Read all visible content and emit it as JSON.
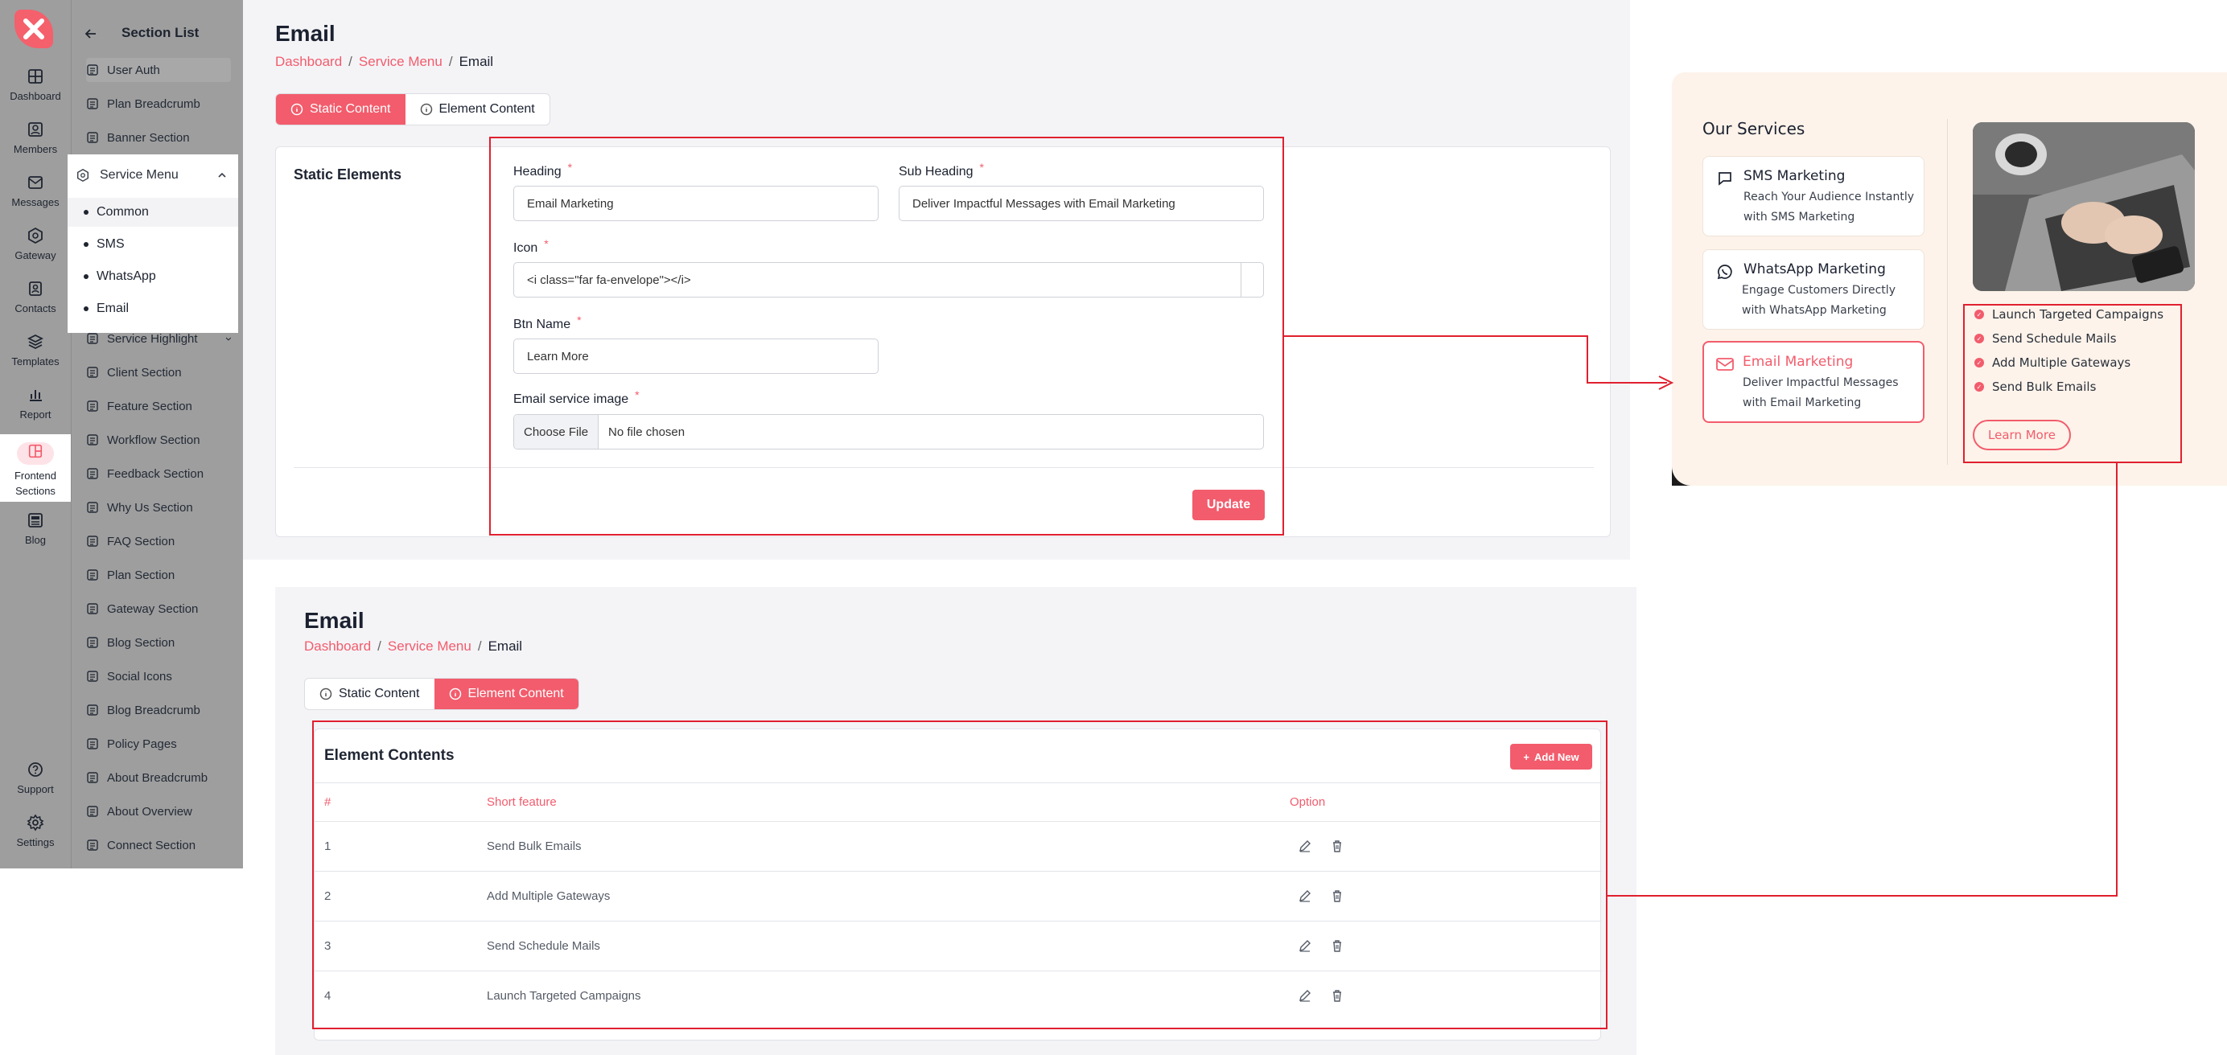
{
  "rail": {
    "items": [
      {
        "label": "Dashboard",
        "icon": "grid-icon"
      },
      {
        "label": "Members",
        "icon": "user-card-icon"
      },
      {
        "label": "Messages",
        "icon": "mail-icon"
      },
      {
        "label": "Gateway",
        "icon": "hexagon-icon"
      },
      {
        "label": "Contacts",
        "icon": "contact-icon"
      },
      {
        "label": "Templates",
        "icon": "layers-icon"
      },
      {
        "label": "Report",
        "icon": "bar-chart-icon"
      },
      {
        "label_line1": "Frontend",
        "label_line2": "Sections",
        "icon": "layout-icon"
      },
      {
        "label": "Blog",
        "icon": "newspaper-icon"
      },
      {
        "label": "Support",
        "icon": "help-icon"
      },
      {
        "label": "Settings",
        "icon": "gear-icon"
      }
    ]
  },
  "section_list": {
    "title": "Section List",
    "items": [
      "User Auth",
      "Plan Breadcrumb",
      "Banner Section",
      "Service Menu",
      "Service Highlight",
      "Client Section",
      "Feature Section",
      "Workflow Section",
      "Feedback Section",
      "Why Us Section",
      "FAQ Section",
      "Plan Section",
      "Gateway Section",
      "Blog Section",
      "Social Icons",
      "Blog Breadcrumb",
      "Policy Pages",
      "About Breadcrumb",
      "About Overview",
      "Connect Section"
    ],
    "submenu": [
      "Common",
      "SMS",
      "WhatsApp",
      "Email"
    ]
  },
  "static_page": {
    "title": "Email",
    "breadcrumb": [
      "Dashboard",
      "Service Menu",
      "Email"
    ],
    "tabs": [
      "Static Content",
      "Element Content"
    ],
    "card_title": "Static Elements",
    "fields": {
      "heading_label": "Heading",
      "heading_value": "Email Marketing",
      "subheading_label": "Sub Heading",
      "subheading_value": "Deliver Impactful Messages with Email Marketing",
      "icon_label": "Icon",
      "icon_value": "<i class=\"far fa-envelope\"></i>",
      "btn_label": "Btn Name",
      "btn_value": "Learn More",
      "image_label": "Email service image",
      "choose_file": "Choose File",
      "no_file": "No file chosen",
      "required_mark": "*"
    },
    "update_label": "Update"
  },
  "element_page": {
    "title": "Email",
    "breadcrumb": [
      "Dashboard",
      "Service Menu",
      "Email"
    ],
    "tabs": [
      "Static Content",
      "Element Content"
    ],
    "card_title": "Element Contents",
    "add_new_label": "Add New",
    "columns": [
      "#",
      "Short feature",
      "Option"
    ],
    "rows": [
      {
        "num": "1",
        "feature": "Send Bulk Emails"
      },
      {
        "num": "2",
        "feature": "Add Multiple Gateways"
      },
      {
        "num": "3",
        "feature": "Send Schedule Mails"
      },
      {
        "num": "4",
        "feature": "Launch Targeted Campaigns"
      }
    ]
  },
  "preview": {
    "heading": "Our Services",
    "services": [
      {
        "title": "SMS Marketing",
        "desc1": "Reach Your Audience Instantly",
        "desc2": "with SMS Marketing",
        "icon": "chat-icon"
      },
      {
        "title": "WhatsApp Marketing",
        "desc1": "Engage Customers Directly",
        "desc2": "with WhatsApp Marketing",
        "icon": "whatsapp-icon"
      },
      {
        "title": "Email Marketing",
        "desc1": "Deliver Impactful Messages",
        "desc2": "with Email Marketing",
        "icon": "envelope-icon"
      }
    ],
    "features": [
      "Launch Targeted Campaigns",
      "Send Schedule Mails",
      "Add Multiple Gateways",
      "Send Bulk Emails"
    ],
    "button": "Learn More"
  },
  "colors": {
    "accent": "#f25c6c",
    "annotation": "#e0202f",
    "sidebar": "#9e9e9e"
  }
}
